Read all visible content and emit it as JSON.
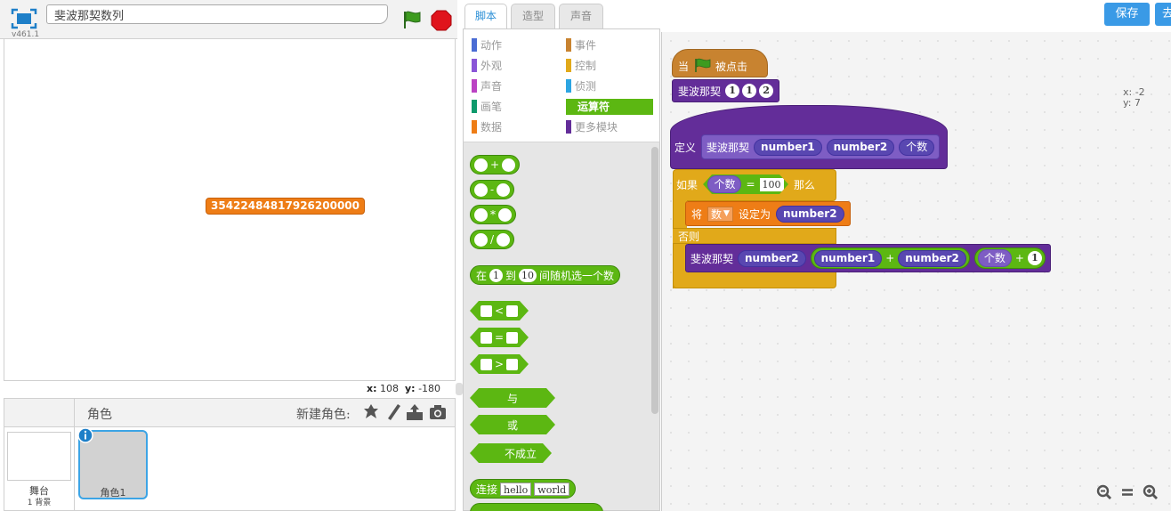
{
  "app": {
    "project_title": "斐波那契数列",
    "version": "v461.1"
  },
  "stage": {
    "monitor_value": "35422484817926200000",
    "coords": {
      "x_label": "x:",
      "x_value": "108",
      "y_label": "y:",
      "y_value": "-180"
    }
  },
  "sprites": {
    "header_label": "角色",
    "new_sprite_label": "新建角色:",
    "stage_name": "舞台",
    "stage_backgrounds": "1 背景",
    "sprite_name": "角色1"
  },
  "tabs": [
    "脚本",
    "造型",
    "声音"
  ],
  "categories": [
    {
      "label": "动作",
      "color": "#4a6cd4"
    },
    {
      "label": "事件",
      "color": "#c88330"
    },
    {
      "label": "外观",
      "color": "#8a55d7"
    },
    {
      "label": "控制",
      "color": "#e1a91a"
    },
    {
      "label": "声音",
      "color": "#bb42c3"
    },
    {
      "label": "侦测",
      "color": "#2ca5e2"
    },
    {
      "label": "画笔",
      "color": "#0e9a6c"
    },
    {
      "label": "运算符",
      "color": "#5cb712"
    },
    {
      "label": "数据",
      "color": "#ee7d16"
    },
    {
      "label": "更多模块",
      "color": "#632d99"
    }
  ],
  "palette": {
    "add": "+",
    "sub": "-",
    "mul": "*",
    "div": "/",
    "random": {
      "prefix": "在",
      "from": "1",
      "mid": "到",
      "to": "10",
      "suffix": "间随机选一个数"
    },
    "lt": "<",
    "eq": "=",
    "gt": ">",
    "and": "与",
    "or": "或",
    "not": "不成立",
    "join": {
      "label": "连接",
      "a": "hello",
      "b": "world"
    }
  },
  "toolbar": {
    "save": "保存",
    "go": "去"
  },
  "mouse": {
    "x": "x: -2",
    "y": "y: 7"
  },
  "script": {
    "hat_when": "当",
    "hat_clicked": "被点击",
    "call_name": "斐波那契",
    "call_args": [
      "1",
      "1",
      "2"
    ],
    "define_label": "定义",
    "define_name": "斐波那契",
    "define_params": [
      "number1",
      "number2",
      "个数"
    ],
    "if_label": "如果",
    "if_var": "个数",
    "if_op": "=",
    "if_value": "100",
    "if_then": "那么",
    "set_label": "将",
    "set_var": "数",
    "set_to": "设定为",
    "set_value": "number2",
    "else_label": "否则",
    "rec_name": "斐波那契",
    "rec_arg1": "number2",
    "rec_sum_a": "number1",
    "rec_sum_op": "+",
    "rec_sum_b": "number2",
    "rec_cnt": "个数",
    "rec_cnt_op": "+",
    "rec_cnt_val": "1"
  },
  "colors": {
    "operators": "#5cb712",
    "events": "#c88330",
    "control": "#e1a91a",
    "data": "#ee7d16",
    "more_blocks": "#632d99",
    "accent": "#3a9ae6"
  }
}
